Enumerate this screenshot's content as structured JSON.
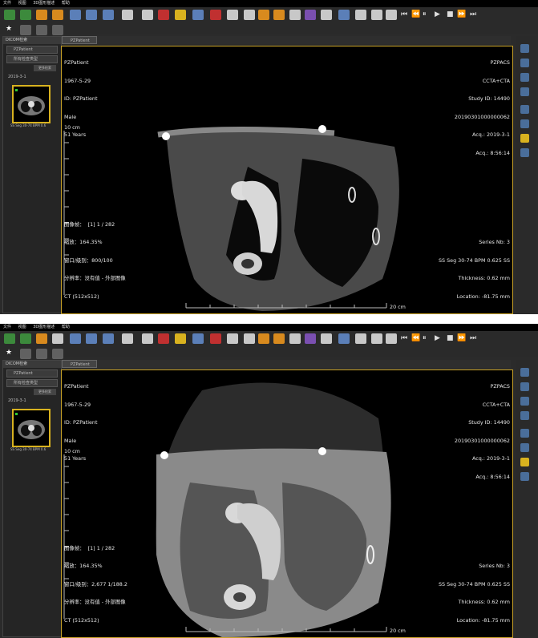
{
  "menu": [
    "文件",
    "视图",
    "3D图形描述",
    "帮助"
  ],
  "sidebar": {
    "title": "DICOM检索",
    "patient_select": "PZPatient",
    "filter_select": "所有检查类型",
    "refresh_button": "更多检索",
    "date": "2019-3-1",
    "thumb_caption": "SS Seg 30-74 BPM 0.6"
  },
  "tab": {
    "label": "PZPatient"
  },
  "windows": [
    {
      "overlay": {
        "top_left": [
          "PZPatient",
          "1967-5-29",
          "ID: PZPatient",
          "Male",
          "51 Years"
        ],
        "top_right": [
          "PZPACS",
          "CCTA+CTA",
          "Study ID: 14490",
          "20190301000000062",
          "Acq.: 2019-3-1",
          "Acq.: 8:56:14"
        ],
        "bottom_left": [
          "图像帧：  [1] 1 / 282",
          "缩放：164.35%",
          "窗口/级别：800/100",
          "分辨率：没有值 - 外部图像",
          "CT (512x512)"
        ],
        "bottom_right": [
          "Series Nb: 3",
          "SS Seg 30-74 BPM 0.625 SS",
          "Thickness: 0.62 mm",
          "Location: -81.75 mm"
        ],
        "scale_v": "10 cm",
        "scale_h": "20 cm"
      }
    },
    {
      "overlay": {
        "top_left": [
          "PZPatient",
          "1967-5-29",
          "ID: PZPatient",
          "Male",
          "51 Years"
        ],
        "top_right": [
          "PZPACS",
          "CCTA+CTA",
          "Study ID: 14490",
          "20190301000000062",
          "Acq.: 2019-3-1",
          "Acq.: 8:56:14"
        ],
        "bottom_left": [
          "图像帧：  [1] 1 / 282",
          "缩放：164.35%",
          "窗口/级别：2,677 1/188.2",
          "分辨率：没有值 - 外部图像",
          "CT (512x512)"
        ],
        "bottom_right": [
          "Series Nb: 3",
          "SS Seg 30-74 BPM 0.625 SS",
          "Thickness: 0.62 mm",
          "Location: -81.75 mm"
        ],
        "scale_v": "10 cm",
        "scale_h": "20 cm"
      }
    }
  ]
}
